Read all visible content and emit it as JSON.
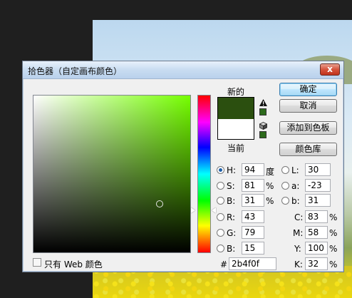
{
  "dialog": {
    "title": "拾色器（自定画布颜色）",
    "close_glyph": "x"
  },
  "swatches": {
    "new_label": "新的",
    "current_label": "当前",
    "new_color": "#2b4f0f",
    "current_color": "#ffffff"
  },
  "buttons": {
    "ok": "确定",
    "cancel": "取消",
    "add_to_swatches": "添加到色板",
    "color_libraries": "颜色库"
  },
  "hsb": {
    "h_label": "H:",
    "h_value": "94",
    "h_unit": "度",
    "s_label": "S:",
    "s_value": "81",
    "s_unit": "%",
    "b_label": "B:",
    "b_value": "31",
    "b_unit": "%"
  },
  "rgb": {
    "r_label": "R:",
    "r_value": "43",
    "g_label": "G:",
    "g_value": "79",
    "b_label": "B:",
    "b_value": "15"
  },
  "lab": {
    "l_label": "L:",
    "l_value": "30",
    "a_label": "a:",
    "a_value": "-23",
    "b_label": "b:",
    "b_value": "31"
  },
  "cmyk": {
    "c_label": "C:",
    "c_value": "83",
    "c_unit": "%",
    "m_label": "M:",
    "m_value": "58",
    "m_unit": "%",
    "y_label": "Y:",
    "y_value": "100",
    "y_unit": "%",
    "k_label": "K:",
    "k_value": "32",
    "k_unit": "%"
  },
  "hex": {
    "label": "#",
    "value": "2b4f0f"
  },
  "web_only": {
    "label": "只有 Web 颜色",
    "checked": false
  },
  "icons": {
    "warning": "gamut-warning-icon",
    "cube": "web-safe-cube-icon"
  }
}
